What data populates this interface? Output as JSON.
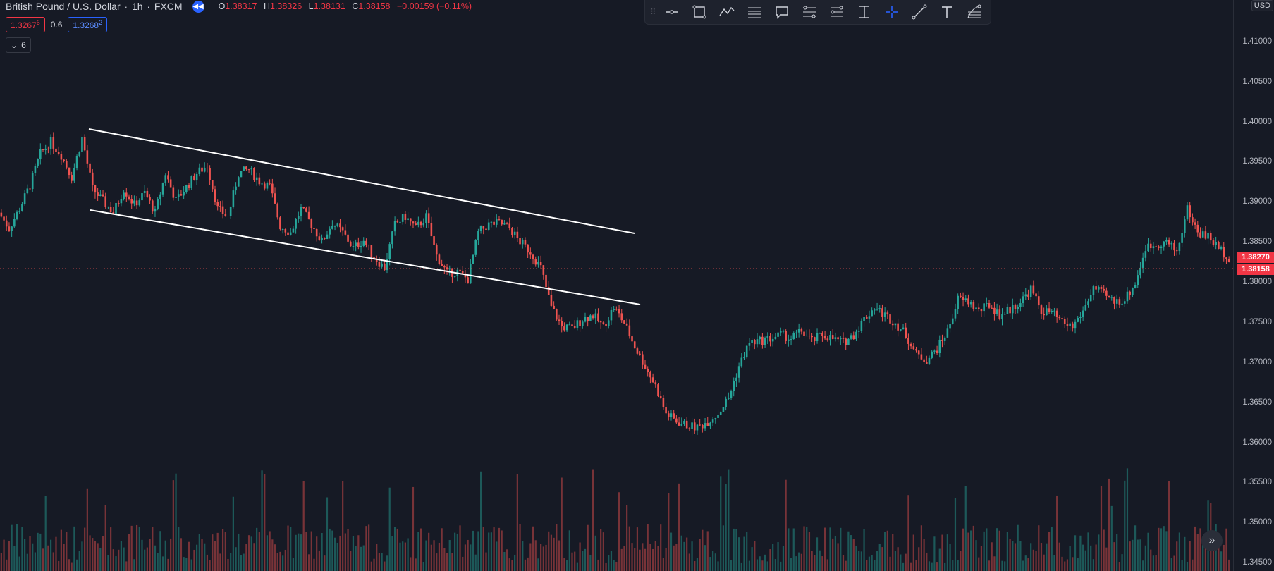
{
  "legend": {
    "symbol": "British Pound / U.S. Dollar",
    "interval": "1h",
    "exchange": "FXCM",
    "open_label": "O",
    "open": "1.38317",
    "high_label": "H",
    "high": "1.38326",
    "low_label": "L",
    "low": "1.38131",
    "close_label": "C",
    "close": "1.38158",
    "change": "−0.00159 (−0.11%)"
  },
  "trade": {
    "sell_price": "1.3267",
    "sell_pip": "6",
    "spread": "0.6",
    "buy_price": "1.3268",
    "buy_pip": "2"
  },
  "indicators_collapse": {
    "count": "6"
  },
  "toolbar": {
    "tools": [
      "horizontal-ray",
      "rectangle",
      "path",
      "pitchfork",
      "callout",
      "fib-retracement",
      "fib-extension",
      "price-range",
      "crosshair",
      "trend-line",
      "text",
      "fib-fan"
    ]
  },
  "axis": {
    "currency": "USD",
    "labels": [
      "1.41000",
      "1.40500",
      "1.40000",
      "1.39500",
      "1.39000",
      "1.38500",
      "1.38000",
      "1.37500",
      "1.37000",
      "1.36500",
      "1.36000",
      "1.35500",
      "1.35000",
      "1.34500"
    ],
    "last_price_top": "1.38270",
    "last_price_bottom": "1.38158"
  },
  "colors": {
    "up": "#26a69a",
    "down": "#ef5350",
    "background": "#161a25",
    "accent": "#2962ff"
  },
  "chart_data": {
    "type": "candlestick",
    "ylim": [
      1.343,
      1.4155
    ],
    "close_path": [
      1.3885,
      1.3865,
      1.389,
      1.392,
      1.396,
      1.3975,
      1.3958,
      1.393,
      1.398,
      1.3915,
      1.39,
      1.3885,
      1.3915,
      1.3895,
      1.391,
      1.3885,
      1.3935,
      1.39,
      1.3918,
      1.3935,
      1.3945,
      1.389,
      1.388,
      1.3935,
      1.394,
      1.3925,
      1.3918,
      1.3868,
      1.386,
      1.389,
      1.387,
      1.3848,
      1.3872,
      1.386,
      1.384,
      1.385,
      1.3828,
      1.3815,
      1.387,
      1.388,
      1.3865,
      1.388,
      1.383,
      1.3808,
      1.381,
      1.38,
      1.386,
      1.387,
      1.3872,
      1.3865,
      1.3848,
      1.3835,
      1.3815,
      1.3765,
      1.374,
      1.3738,
      1.375,
      1.3755,
      1.374,
      1.3765,
      1.3745,
      1.3715,
      1.369,
      1.3665,
      1.363,
      1.362,
      1.3615,
      1.3612,
      1.362,
      1.363,
      1.365,
      1.369,
      1.372,
      1.3722,
      1.3725,
      1.373,
      1.3725,
      1.3735,
      1.3722,
      1.373,
      1.3725,
      1.372,
      1.373,
      1.375,
      1.3765,
      1.3755,
      1.3745,
      1.373,
      1.3705,
      1.3698,
      1.3712,
      1.3735,
      1.3775,
      1.3772,
      1.376,
      1.3768,
      1.3755,
      1.3762,
      1.3772,
      1.3788,
      1.376,
      1.3758,
      1.3745,
      1.374,
      1.376,
      1.379,
      1.378,
      1.3772,
      1.3775,
      1.3795,
      1.384,
      1.3845,
      1.3848,
      1.3835,
      1.389,
      1.386,
      1.3855,
      1.384,
      1.3828
    ]
  }
}
